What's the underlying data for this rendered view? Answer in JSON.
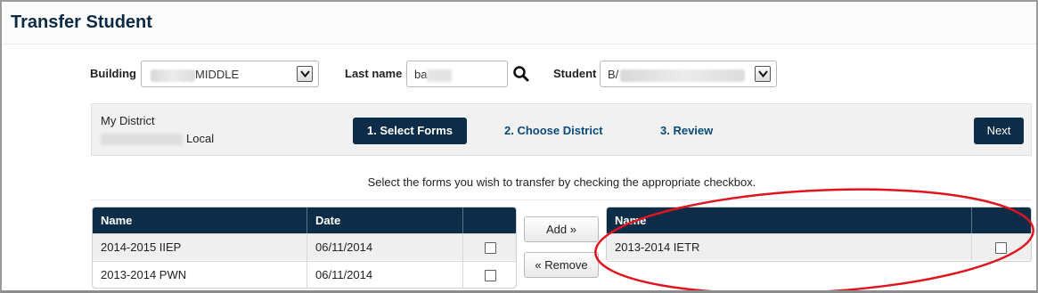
{
  "page": {
    "title": "Transfer Student"
  },
  "filters": {
    "building_label": "Building",
    "building_value": "MIDDLE",
    "lastname_label": "Last name",
    "lastname_value": "ba",
    "student_label": "Student",
    "student_value": "B/"
  },
  "wizard": {
    "district_label": "My District",
    "district_name": "Local",
    "steps": [
      {
        "label": "1. Select Forms",
        "active": true
      },
      {
        "label": "2. Choose District",
        "active": false
      },
      {
        "label": "3. Review",
        "active": false
      }
    ],
    "next_label": "Next"
  },
  "instruction": "Select the forms you wish to transfer by checking the appropriate checkbox.",
  "available_forms": {
    "headers": [
      "Name",
      "Date",
      ""
    ],
    "rows": [
      {
        "name": "2014-2015 IIEP",
        "date": "06/11/2014",
        "checked": false
      },
      {
        "name": "2013-2014 PWN",
        "date": "06/11/2014",
        "checked": false
      }
    ]
  },
  "actions": {
    "add_label": "Add »",
    "remove_label": "« Remove"
  },
  "selected_forms": {
    "headers": [
      "Name",
      ""
    ],
    "rows": [
      {
        "name": "2013-2014 IETR",
        "checked": false
      }
    ]
  },
  "colors": {
    "header_navy": "#0c2c47",
    "link_blue": "#0b4a78",
    "annotation_red": "#e0141e"
  }
}
